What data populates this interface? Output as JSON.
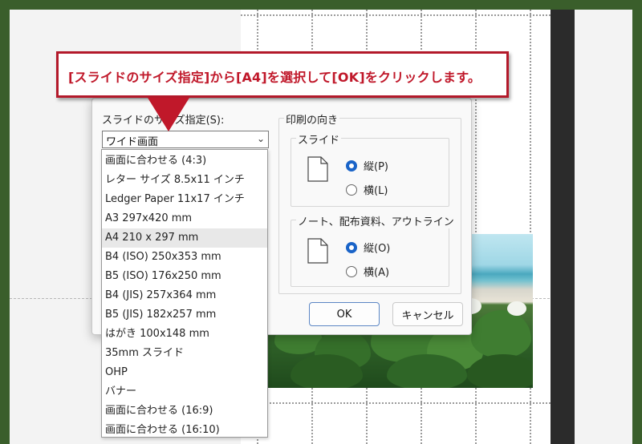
{
  "callout": {
    "text": "[スライドのサイズ指定]から[A4]を選択して[OK]をクリックします。",
    "color": "#c0182a"
  },
  "dialog": {
    "size_label": "スライドのサイズ指定(S):",
    "size_selected": "ワイド画面",
    "size_options": [
      "画面に合わせる (4:3)",
      "レター サイズ 8.5x11 インチ",
      "Ledger Paper 11x17 インチ",
      "A3 297x420 mm",
      "A4 210 x 297 mm",
      "B4 (ISO) 250x353 mm",
      "B5 (ISO) 176x250 mm",
      "B4 (JIS) 257x364 mm",
      "B5 (JIS) 182x257 mm",
      "はがき 100x148 mm",
      "35mm スライド",
      "OHP",
      "バナー",
      "画面に合わせる (16:9)",
      "画面に合わせる (16:10)"
    ],
    "highlighted_option": "A4 210 x 297 mm",
    "orientation_title": "印刷の向き",
    "slide_group": {
      "title": "スライド",
      "portrait_label": "縦(P)",
      "landscape_label": "横(L)",
      "selected": "portrait"
    },
    "notes_group": {
      "title": "ノート、配布資料、アウトライン",
      "portrait_label": "縦(O)",
      "landscape_label": "横(A)",
      "selected": "portrait"
    },
    "ok_label": "OK",
    "cancel_label": "キャンセル",
    "accent_color": "#1a64c8"
  }
}
